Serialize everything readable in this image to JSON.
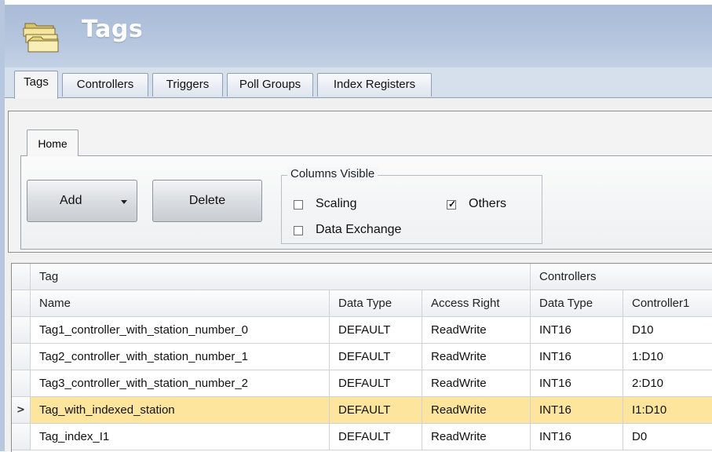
{
  "window": {
    "title": "Tags"
  },
  "tabs": [
    {
      "label": "Tags",
      "active": true
    },
    {
      "label": "Controllers",
      "active": false
    },
    {
      "label": "Triggers",
      "active": false
    },
    {
      "label": "Poll Groups",
      "active": false
    },
    {
      "label": "Index Registers",
      "active": false
    }
  ],
  "ribbon": {
    "tab": "Home",
    "add_label": "Add",
    "delete_label": "Delete",
    "columns_visible": {
      "legend": "Columns Visible",
      "options": [
        {
          "label": "Scaling",
          "checked": false
        },
        {
          "label": "Others",
          "checked": true
        },
        {
          "label": "Data Exchange",
          "checked": false
        }
      ]
    }
  },
  "grid": {
    "group_headers": {
      "tag": "Tag",
      "controllers": "Controllers"
    },
    "columns": [
      "Name",
      "Data Type",
      "Access Right",
      "Data Type",
      "Controller1"
    ],
    "rows": [
      {
        "name": "Tag1_controller_with_station_number_0",
        "data_type": "DEFAULT",
        "access": "ReadWrite",
        "ctrl_type": "INT16",
        "controller1": "D10",
        "selected": false
      },
      {
        "name": "Tag2_controller_with_station_number_1",
        "data_type": "DEFAULT",
        "access": "ReadWrite",
        "ctrl_type": "INT16",
        "controller1": "1:D10",
        "selected": false
      },
      {
        "name": "Tag3_controller_with_station_number_2",
        "data_type": "DEFAULT",
        "access": "ReadWrite",
        "ctrl_type": "INT16",
        "controller1": "2:D10",
        "selected": false
      },
      {
        "name": "Tag_with_indexed_station",
        "data_type": "DEFAULT",
        "access": "ReadWrite",
        "ctrl_type": "INT16",
        "controller1": "I1:D10",
        "selected": true
      },
      {
        "name": "Tag_index_I1",
        "data_type": "DEFAULT",
        "access": "ReadWrite",
        "ctrl_type": "INT16",
        "controller1": "D0",
        "selected": false
      }
    ],
    "current_row_marker": ">"
  },
  "colors": {
    "header_bg": "#b6c6de",
    "selected_row": "#fde59d"
  },
  "icons": {
    "title_icon": "stacked-folders-icon"
  }
}
